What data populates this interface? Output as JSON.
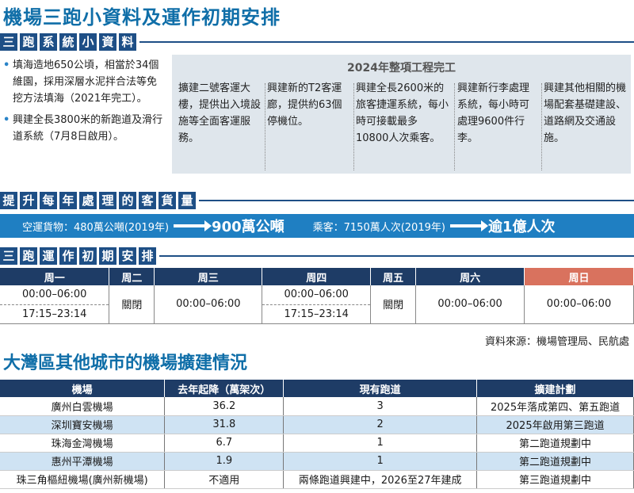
{
  "main_title": "機場三跑小資料及運作初期安排",
  "section1": {
    "chars": [
      "三",
      "跑",
      "系",
      "統",
      "小",
      "資",
      "料"
    ]
  },
  "left_bullets": [
    "填海造地650公頃，相當於34個維園，採用深層水泥拌合法等免挖方法填海（2021年完工）。",
    "興建全長3800米的新跑道及滑行道系統（7月8日啟用）。"
  ],
  "grey_box": {
    "title": "2024年整項工程完工",
    "items": [
      "擴建二號客運大樓，提供出入境設施等全面客運服務。",
      "興建新的T2客運廊，提供約63個停機位。",
      "興建全長2600米的旅客捷運系統，每小時可接載最多10800人次乘客。",
      "興建新行李處理系統，每小時可處理9600件行李。",
      "興建其他相關的機場配套基礎建設、道路網及交通設施。"
    ]
  },
  "section2": {
    "chars": [
      "提",
      "升",
      "每",
      "年",
      "處",
      "理",
      "的",
      "客",
      "貨",
      "量"
    ]
  },
  "flow": {
    "cargo_label": "空運貨物：480萬公噸(2019年)",
    "cargo_target": "900萬公噸",
    "pax_label": "乘客：7150萬人次(2019年)",
    "pax_target": "逾1億人次"
  },
  "section3": {
    "chars": [
      "三",
      "跑",
      "運",
      "作",
      "初",
      "期",
      "安",
      "排"
    ]
  },
  "schedule": {
    "headers": [
      "周一",
      "周二",
      "周三",
      "周四",
      "周五",
      "周六",
      "周日"
    ],
    "mon": [
      "00:00–06:00",
      "17:15–23:14"
    ],
    "tue": "關閉",
    "wed": "00:00–06:00",
    "thu": [
      "00:00–06:00",
      "17:15–23:14"
    ],
    "fri": "關閉",
    "sat": "00:00–06:00",
    "sun": "00:00–06:00"
  },
  "source": "資料來源：機場管理局、民航處",
  "sub_title": "大灣區其他城市的機場擴建情況",
  "airports": {
    "headers": [
      "機場",
      "去年起降（萬架次）",
      "現有跑道",
      "擴建計劃"
    ],
    "rows": [
      [
        "廣州白雲機場",
        "36.2",
        "3",
        "2025年落成第四、第五跑道"
      ],
      [
        "深圳寶安機場",
        "31.8",
        "2",
        "2025年啟用第三跑道"
      ],
      [
        "珠海金灣機場",
        "6.7",
        "1",
        "第二跑道規劃中"
      ],
      [
        "惠州平潭機場",
        "1.9",
        "1",
        "第二跑道規劃中"
      ],
      [
        "珠三角樞紐機場(廣州新機場)",
        "不適用",
        "兩條跑道興建中，2026至27年建成",
        "第三跑道規劃中"
      ]
    ]
  },
  "colors": {
    "title_blue": "#0f6ea8",
    "navy": "#1e3c66",
    "band_blue": "#1f7fc2",
    "sunday": "#d9725e",
    "row_alt": "#cfe3f3",
    "grey_box": "#dfe6ec"
  }
}
